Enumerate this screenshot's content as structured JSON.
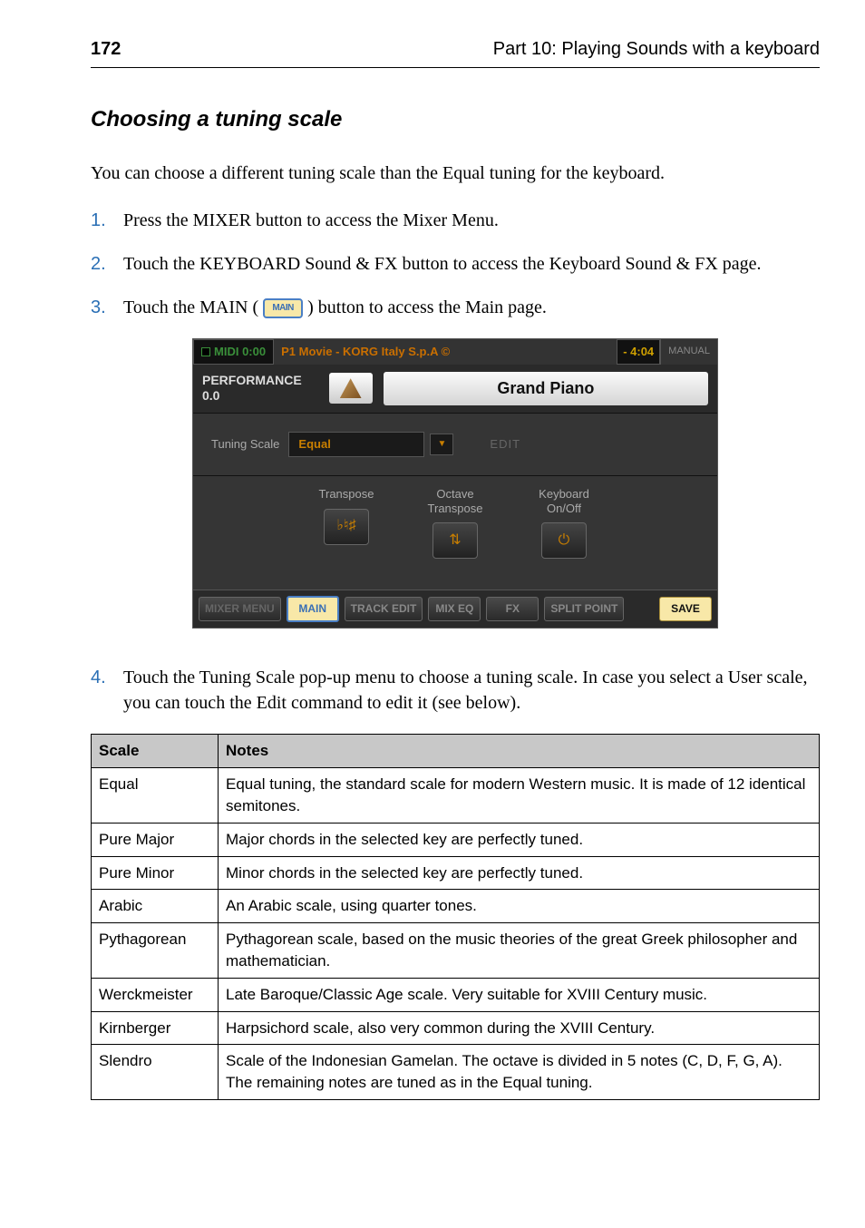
{
  "header": {
    "page_number": "172",
    "part_title": "Part 10: Playing Sounds with a keyboard"
  },
  "section": {
    "heading": "Choosing a tuning scale",
    "intro": "You can choose a different tuning scale than the Equal tuning for the keyboard."
  },
  "steps": [
    {
      "num": "1.",
      "text": "Press the MIXER button to access the Mixer Menu."
    },
    {
      "num": "2.",
      "text": "Touch the KEYBOARD Sound & FX button to access the Keyboard Sound & FX page."
    },
    {
      "num": "3.",
      "text_pre": "Touch the MAIN (",
      "icon_label": "MAIN",
      "text_post": ") button to access the Main page."
    },
    {
      "num": "4.",
      "text": "Touch the Tuning Scale pop-up menu to choose a tuning scale. In case you select a User scale, you can touch the Edit command to edit it (see below)."
    }
  ],
  "ui": {
    "midi": "MIDI",
    "midi_time": "0:00",
    "title": "P1 Movie - KORG Italy S.p.A ©",
    "remaining": "- 4:04",
    "manual": "MANUAL",
    "performance_label": "PERFORMANCE",
    "performance_value": "0.0",
    "sound_name": "Grand Piano",
    "tuning_label": "Tuning Scale",
    "tuning_value": "Equal",
    "edit_label": "EDIT",
    "transpose_labels": {
      "transpose": "Transpose",
      "octave": "Octave Transpose",
      "keyboard": "Keyboard On/Off"
    },
    "btn_transpose": "♭♮♯",
    "btn_octave": "⇅",
    "btn_power": "⏻",
    "tabs": {
      "mixer_menu": "MIXER MENU",
      "main": "MAIN",
      "track_edit": "TRACK EDIT",
      "mix_eq": "MIX EQ",
      "fx": "FX",
      "split_point": "SPLIT POINT",
      "save": "SAVE"
    }
  },
  "table": {
    "headers": {
      "scale": "Scale",
      "notes": "Notes"
    },
    "rows": [
      {
        "scale": "Equal",
        "notes": "Equal tuning, the standard scale for modern Western music. It is made of 12 identical semitones."
      },
      {
        "scale": "Pure Major",
        "notes": "Major chords in the selected key are perfectly tuned."
      },
      {
        "scale": "Pure Minor",
        "notes": "Minor chords in the selected key are perfectly tuned."
      },
      {
        "scale": "Arabic",
        "notes": "An Arabic scale, using quarter tones."
      },
      {
        "scale": "Pythagorean",
        "notes": "Pythagorean scale, based on the music theories of the great Greek philosopher and mathematician."
      },
      {
        "scale": "Werckmeister",
        "notes": "Late Baroque/Classic Age scale. Very suitable for XVIII Century music."
      },
      {
        "scale": "Kirnberger",
        "notes": "Harpsichord scale, also very common during the XVIII Century."
      },
      {
        "scale": "Slendro",
        "notes": "Scale of the Indonesian Gamelan. The octave is divided in 5 notes (C, D, F, G, A). The remaining notes are tuned as in the Equal tuning."
      }
    ]
  }
}
